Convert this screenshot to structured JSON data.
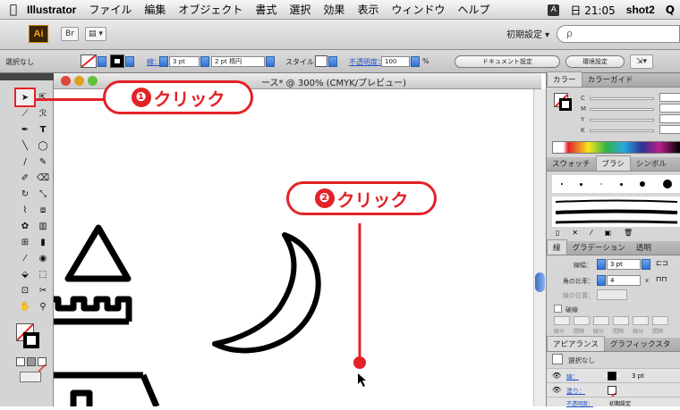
{
  "menubar": {
    "apple": "",
    "app_name": "Illustrator",
    "items": [
      "ファイル",
      "編集",
      "オブジェクト",
      "書式",
      "選択",
      "効果",
      "表示",
      "ウィンドウ",
      "ヘルプ"
    ],
    "input_badge": "A",
    "clock": "日 21:05",
    "user": "shot2",
    "search_glyph": "Q"
  },
  "appbar": {
    "logo": "Ai",
    "bridge_label": "Br",
    "workspace": "初期設定 ▾",
    "search_glyph": "ρ"
  },
  "controlbar": {
    "selection": "選択なし",
    "stroke_label": "線：",
    "stroke_value": "3 pt",
    "brush_value": "2 pt 楕円",
    "style_label": "スタイル：",
    "opacity_label": "不透明度：",
    "opacity_value": "100",
    "percent": "%",
    "doc_settings": "ドキュメント設定",
    "prefs": "環境設定"
  },
  "document": {
    "title": "ース* @ 300% (CMYK/プレビュー)"
  },
  "panels": {
    "color_tabs": [
      "カラー",
      "カラーガイド"
    ],
    "color_channels": [
      "C",
      "M",
      "Y",
      "K"
    ],
    "swatch_tabs": [
      "スウォッチ",
      "ブラシ",
      "シンボル"
    ],
    "stroke_tabs": [
      "線",
      "グラデーション",
      "透明"
    ],
    "stroke_weight_label": "線幅：",
    "stroke_weight_value": "3 pt",
    "miter_label": "角の比率：",
    "miter_value": "4",
    "miter_x": "x",
    "align_label": "線の位置：",
    "dashed_label": "破線",
    "dash_labels": [
      "線分",
      "間隔",
      "線分",
      "間隔",
      "線分",
      "間隔"
    ],
    "appearance_tabs": [
      "アピアランス",
      "グラフィックスタ"
    ],
    "appearance_selection": "選択なし",
    "appearance_stroke_label": "線：",
    "appearance_stroke_value": "3 pt",
    "appearance_fill_label": "塗り：",
    "appearance_opacity_label": "不透明度：",
    "appearance_opacity_value": "初期設定"
  },
  "annotations": {
    "step1_num": "❶",
    "step1_text": "クリック",
    "step2_num": "❷",
    "step2_text": "クリック",
    "accent": "#e32227"
  }
}
